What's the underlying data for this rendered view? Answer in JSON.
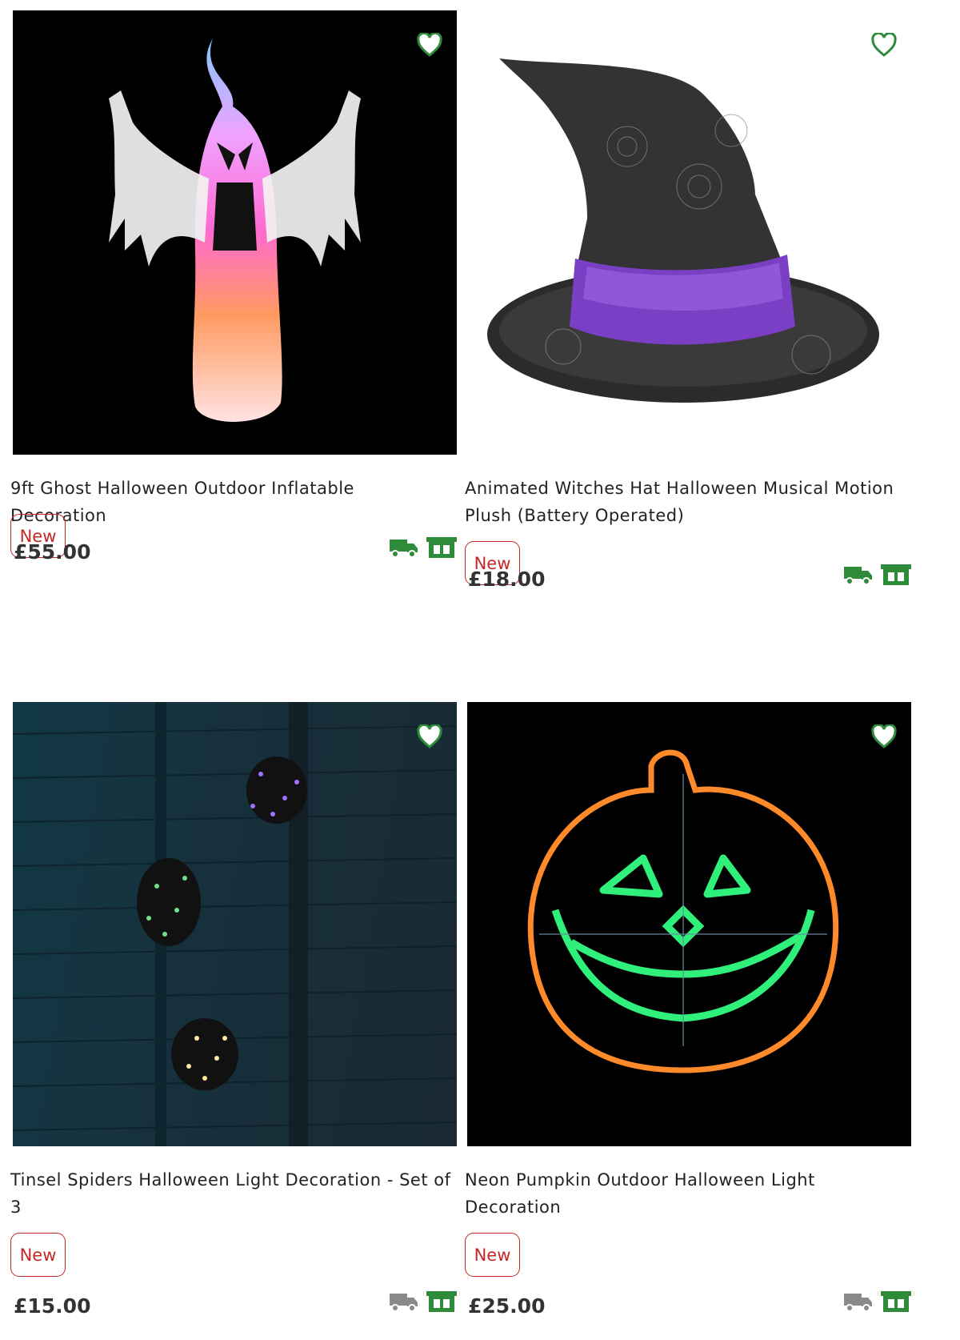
{
  "products": [
    {
      "title": "9ft Ghost Halloween Outdoor Inflatable Decoration",
      "badge": "New",
      "price": "£55.00",
      "delivery_icon": "truck-icon",
      "delivery_color": "#2e8b3a",
      "store_icon": "store-icon",
      "store_color": "#2e8b3a",
      "wishlist_icon": "heart-icon"
    },
    {
      "title": "Animated Witches Hat Halloween Musical Motion Plush (Battery Operated)",
      "badge": "New",
      "price": "£18.00",
      "delivery_icon": "truck-icon",
      "delivery_color": "#2e8b3a",
      "store_icon": "store-icon",
      "store_color": "#2e8b3a",
      "wishlist_icon": "heart-icon"
    },
    {
      "title": "Tinsel Spiders Halloween Light Decoration - Set of 3",
      "badge": "New",
      "price": "£15.00",
      "delivery_icon": "truck-icon",
      "delivery_color": "#8a8a8a",
      "store_icon": "store-icon",
      "store_color": "#2e8b3a",
      "wishlist_icon": "heart-icon"
    },
    {
      "title": "Neon Pumpkin Outdoor Halloween Light Decoration",
      "badge": "New",
      "price": "£25.00",
      "delivery_icon": "truck-icon",
      "delivery_color": "#8a8a8a",
      "store_icon": "store-icon",
      "store_color": "#2e8b3a",
      "wishlist_icon": "heart-icon"
    }
  ],
  "colors": {
    "brand_green": "#2e8b3a",
    "badge_red": "#c62828",
    "unavailable_grey": "#8a8a8a"
  }
}
